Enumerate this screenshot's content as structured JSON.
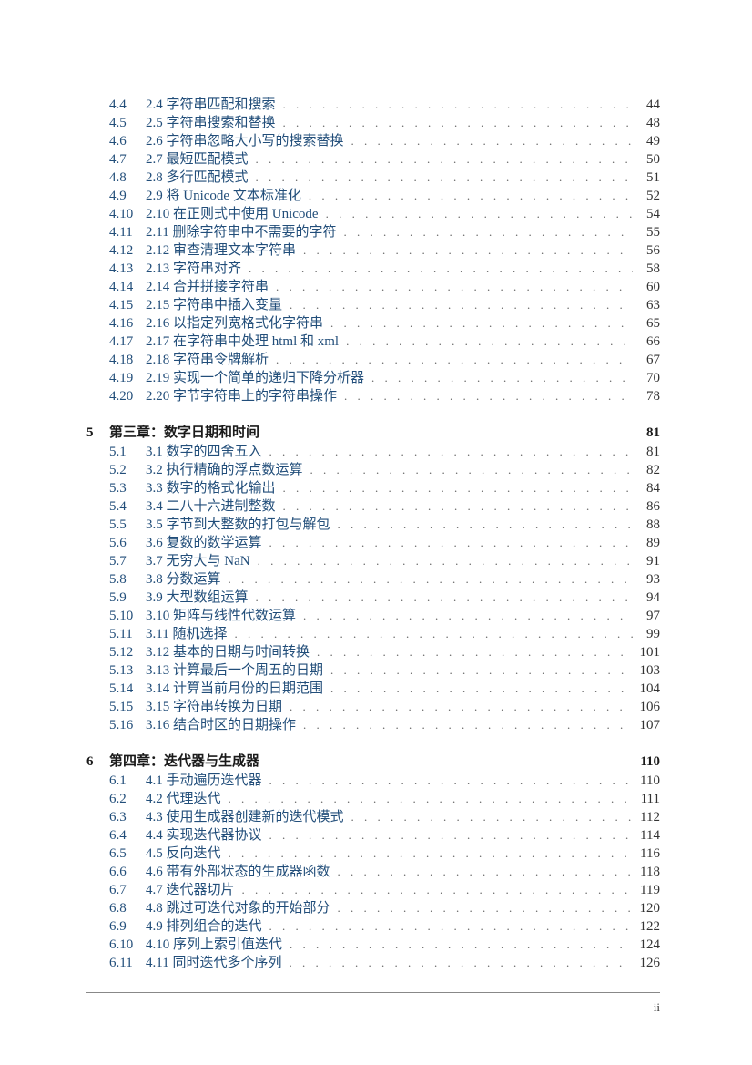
{
  "page_number": "ii",
  "orphan_entries": [
    {
      "num": "4.4",
      "title": "2.4 字符串匹配和搜索",
      "page": "44"
    },
    {
      "num": "4.5",
      "title": "2.5 字符串搜索和替换",
      "page": "48"
    },
    {
      "num": "4.6",
      "title": "2.6 字符串忽略大小写的搜索替换",
      "page": "49"
    },
    {
      "num": "4.7",
      "title": "2.7 最短匹配模式",
      "page": "50"
    },
    {
      "num": "4.8",
      "title": "2.8 多行匹配模式",
      "page": "51"
    },
    {
      "num": "4.9",
      "title": "2.9 将 Unicode 文本标准化",
      "page": "52"
    },
    {
      "num": "4.10",
      "title": "2.10 在正则式中使用 Unicode",
      "page": "54"
    },
    {
      "num": "4.11",
      "title": "2.11 删除字符串中不需要的字符",
      "page": "55"
    },
    {
      "num": "4.12",
      "title": "2.12 审查清理文本字符串",
      "page": "56"
    },
    {
      "num": "4.13",
      "title": "2.13 字符串对齐",
      "page": "58"
    },
    {
      "num": "4.14",
      "title": "2.14 合并拼接字符串",
      "page": "60"
    },
    {
      "num": "4.15",
      "title": "2.15 字符串中插入变量",
      "page": "63"
    },
    {
      "num": "4.16",
      "title": "2.16 以指定列宽格式化字符串",
      "page": "65"
    },
    {
      "num": "4.17",
      "title": "2.17 在字符串中处理 html 和 xml",
      "page": "66"
    },
    {
      "num": "4.18",
      "title": "2.18 字符串令牌解析",
      "page": "67"
    },
    {
      "num": "4.19",
      "title": "2.19 实现一个简单的递归下降分析器",
      "page": "70"
    },
    {
      "num": "4.20",
      "title": "2.20 字节字符串上的字符串操作",
      "page": "78"
    }
  ],
  "chapters": [
    {
      "chap_num": "5",
      "chap_title": "第三章：数字日期和时间",
      "chap_page": "81",
      "entries": [
        {
          "num": "5.1",
          "title": "3.1 数字的四舍五入",
          "page": "81"
        },
        {
          "num": "5.2",
          "title": "3.2 执行精确的浮点数运算",
          "page": "82"
        },
        {
          "num": "5.3",
          "title": "3.3 数字的格式化输出",
          "page": "84"
        },
        {
          "num": "5.4",
          "title": "3.4 二八十六进制整数",
          "page": "86"
        },
        {
          "num": "5.5",
          "title": "3.5 字节到大整数的打包与解包",
          "page": "88"
        },
        {
          "num": "5.6",
          "title": "3.6 复数的数学运算",
          "page": "89"
        },
        {
          "num": "5.7",
          "title": "3.7 无穷大与 NaN",
          "page": "91"
        },
        {
          "num": "5.8",
          "title": "3.8 分数运算",
          "page": "93"
        },
        {
          "num": "5.9",
          "title": "3.9 大型数组运算",
          "page": "94"
        },
        {
          "num": "5.10",
          "title": "3.10 矩阵与线性代数运算",
          "page": "97"
        },
        {
          "num": "5.11",
          "title": "3.11 随机选择",
          "page": "99"
        },
        {
          "num": "5.12",
          "title": "3.12 基本的日期与时间转换",
          "page": "101"
        },
        {
          "num": "5.13",
          "title": "3.13 计算最后一个周五的日期",
          "page": "103"
        },
        {
          "num": "5.14",
          "title": "3.14 计算当前月份的日期范围",
          "page": "104"
        },
        {
          "num": "5.15",
          "title": "3.15 字符串转换为日期",
          "page": "106"
        },
        {
          "num": "5.16",
          "title": "3.16 结合时区的日期操作",
          "page": "107"
        }
      ]
    },
    {
      "chap_num": "6",
      "chap_title": "第四章：迭代器与生成器",
      "chap_page": "110",
      "entries": [
        {
          "num": "6.1",
          "title": "4.1 手动遍历迭代器",
          "page": "110"
        },
        {
          "num": "6.2",
          "title": "4.2 代理迭代",
          "page": "111"
        },
        {
          "num": "6.3",
          "title": "4.3 使用生成器创建新的迭代模式",
          "page": "112"
        },
        {
          "num": "6.4",
          "title": "4.4 实现迭代器协议",
          "page": "114"
        },
        {
          "num": "6.5",
          "title": "4.5 反向迭代",
          "page": "116"
        },
        {
          "num": "6.6",
          "title": "4.6 带有外部状态的生成器函数",
          "page": "118"
        },
        {
          "num": "6.7",
          "title": "4.7 迭代器切片",
          "page": "119"
        },
        {
          "num": "6.8",
          "title": "4.8 跳过可迭代对象的开始部分",
          "page": "120"
        },
        {
          "num": "6.9",
          "title": "4.9 排列组合的迭代",
          "page": "122"
        },
        {
          "num": "6.10",
          "title": "4.10 序列上索引值迭代",
          "page": "124"
        },
        {
          "num": "6.11",
          "title": "4.11 同时迭代多个序列",
          "page": "126"
        }
      ]
    }
  ]
}
